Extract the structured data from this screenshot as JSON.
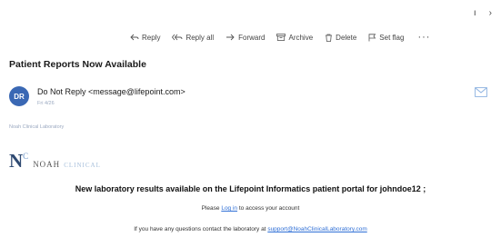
{
  "window": {
    "minimize_glyph": "ı",
    "close_glyph": "›"
  },
  "toolbar": {
    "reply": "Reply",
    "reply_all": "Reply all",
    "forward": "Forward",
    "archive": "Archive",
    "delete": "Delete",
    "set_flag": "Set flag",
    "more": "···"
  },
  "email": {
    "subject": "Patient Reports Now Available",
    "avatar_initials": "DR",
    "sender": "Do Not Reply <message@lifepoint.com>",
    "date": "Fri 4/26",
    "lab_tag": "Noah Clinical Laboratory"
  },
  "body": {
    "logo_letter": "N",
    "logo_superscript": "C",
    "logo_word": "NOAH",
    "logo_subword": "CLINICAL",
    "headline": "New laboratory results available on the Lifepoint Informatics patient portal for johndoe12 ;",
    "line1_before": "Please",
    "line1_link": "Log in",
    "line1_after": "to access your account",
    "line2_before": "If you have any questions contact the laboratory at",
    "line2_link": "support@NoahClinicalLaboratory.com"
  },
  "colors": {
    "accent": "#2f6fd6",
    "avatar": "#3a68b4",
    "logo": "#2f4a72"
  }
}
